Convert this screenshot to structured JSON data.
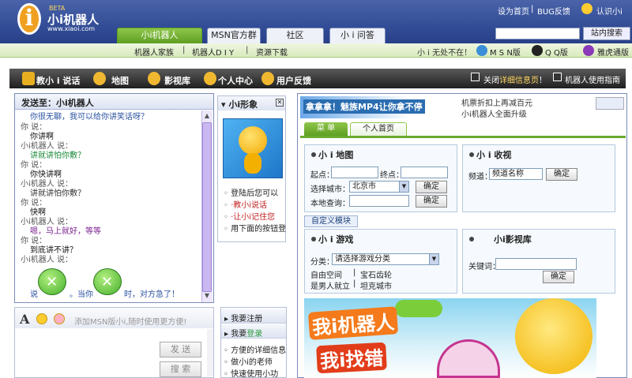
{
  "header": {
    "logo_beta": "BETA",
    "logo_name": "小i机器人",
    "logo_url": "www.xiaoi.com",
    "top_links": [
      "设为首页",
      "BUG反馈"
    ],
    "toplinks_sep": "|",
    "user_label": "认识小i",
    "search_placeholder": "",
    "search_button": "站内搜索"
  },
  "tabs": [
    {
      "label": "小i机器人",
      "active": true
    },
    {
      "label": "MSN官方群",
      "active": false
    },
    {
      "label": "社区",
      "active": false
    },
    {
      "label": "小 i 问答",
      "active": false
    }
  ],
  "subnav": {
    "items": [
      "机器人家族",
      "机器人D I Y",
      "资源下载"
    ],
    "sep": "|",
    "slogan": "小 i 无处不在！",
    "versions": [
      "M S N版",
      "Q Q版",
      "雅虎通版"
    ]
  },
  "toolbar": {
    "items": [
      "教小 i 说话",
      "地图",
      "影视库",
      "个人中心",
      "用户反馈"
    ],
    "link1_prefix": "关闭",
    "link1_highlight": "详细信息页",
    "link1_suffix": "！",
    "link2": "机器人使用指南"
  },
  "chat": {
    "title": "发送至：小i机器人",
    "messages": [
      {
        "who": "",
        "text": "你很无聊，我可以给你讲笑话呀？",
        "cls": "robot-blue"
      },
      {
        "who": "你 说：",
        "text": "你讲啊",
        "cls": "mine"
      },
      {
        "who": "小i机器人 说：",
        "text": "讲就讲怕你敷？",
        "cls": "robot"
      },
      {
        "who": "你 说：",
        "text": "你快讲啊",
        "cls": "mine"
      },
      {
        "who": "小i机器人 说：",
        "text": "讲就讲怕你敷？",
        "cls": "robot-blue"
      },
      {
        "who": "你 说：",
        "text": "快啊",
        "cls": "mine"
      },
      {
        "who": "小i机器人 说：",
        "text": "嗯，马上就好，等等",
        "cls": "robot"
      },
      {
        "who": "你 说：",
        "text": "到底讲不讲？",
        "cls": "mine"
      },
      {
        "who": "小i机器人 说：",
        "text": "",
        "cls": "robot"
      }
    ],
    "emo_line_parts": [
      "说",
      "。当你",
      "时，对方急了！"
    ]
  },
  "input": {
    "tip": "添加MSN版小i,随时使用更方便!",
    "send": "发 送",
    "search": "搜 索"
  },
  "xi_panel": {
    "title": "小i形象",
    "close": "✕",
    "tips": [
      "登陆后您可以",
      "·教小i说话",
      "·让小i记住您",
      "用下面的按钮登"
    ]
  },
  "side_panel": {
    "register": "我要注册",
    "login_prefix": "我要",
    "login_highlight": "登录",
    "items": [
      "方便的详细信息",
      "做小i的老师",
      "快速使用小功"
    ]
  },
  "right": {
    "banner_text": "拿拿拿！魅族MP4让你拿不停",
    "news": [
      "机票折扣上再减百元",
      "小i机器人全面升级"
    ],
    "tabs": [
      "菜 单",
      "个人首页"
    ],
    "map": {
      "title": "小 i 地图",
      "start": "起点：",
      "end": "终点：",
      "city_label": "选择城市：",
      "city_value": "北京市",
      "local_label": "本地查询：",
      "ok": "确定"
    },
    "tv": {
      "title": "小 i 收视",
      "channel_label": "频道：",
      "channel_value": "频道名称",
      "ok": "确定"
    },
    "custom_module": "自定义模块",
    "game": {
      "title": "小 i 游戏",
      "cat_label": "分类：",
      "cat_value": "请选择游戏分类",
      "links": [
        "自由空间",
        "宝石齿轮",
        "是男人就立",
        "坦克城市"
      ],
      "sep": "|"
    },
    "movie": {
      "title": "小i影视库",
      "kw_label": "关键词：",
      "ok": "确定"
    },
    "promo": {
      "line1": "我i机器人",
      "line2": "我i找错"
    }
  },
  "colors": {
    "header": "#2f4a93",
    "accent_green": "#5e9e22",
    "toolbar": "#1f1f1f"
  }
}
